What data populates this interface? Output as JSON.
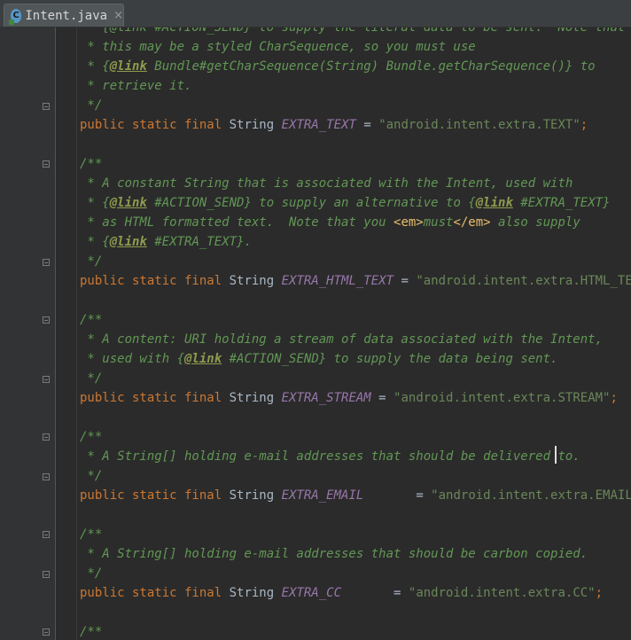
{
  "tab": {
    "label": "Intent.java",
    "icon": "java-class-icon",
    "close": "×"
  },
  "colors": {
    "keyword": "#cc7832",
    "comment": "#629755",
    "string": "#6a8759",
    "constant": "#9876aa",
    "text": "#a9b7c6",
    "background": "#2b2b2b"
  },
  "code": {
    "l0": " * {@link #ACTION_SEND} to supply the literal data to be sent.  Note that",
    "l1": " * this may be a styled CharSequence, so you must use",
    "l2a": " * {",
    "l2b": "@link",
    "l2c": " Bundle#getCharSequence(String) Bundle.getCharSequence()} to",
    "l3": " * retrieve it.",
    "l4": " */",
    "l5": {
      "mod": "public static final",
      "type": " String ",
      "name": "EXTRA_TEXT",
      "eq": " = ",
      "value": "\"android.intent.extra.TEXT\"",
      "end": ";"
    },
    "l7": "/**",
    "l8": " * A constant String that is associated with the Intent, used with",
    "l9a": " * {",
    "l9b": "@link",
    "l9c": " #ACTION_SEND} to supply an alternative to {",
    "l9d": "@link",
    "l9e": " #EXTRA_TEXT}",
    "l10a": " * as HTML formatted text.  Note that you ",
    "l10b": "<em>",
    "l10c": "must",
    "l10d": "</em>",
    "l10e": " also supply",
    "l11a": " * {",
    "l11b": "@link",
    "l11c": " #EXTRA_TEXT}.",
    "l12": " */",
    "l13": {
      "mod": "public static final",
      "type": " String ",
      "name": "EXTRA_HTML_TEXT",
      "eq": " = ",
      "value": "\"android.intent.extra.HTML_TEXT\"",
      "end": ";"
    },
    "l15": "/**",
    "l16": " * A content: URI holding a stream of data associated with the Intent,",
    "l17a": " * used with {",
    "l17b": "@link",
    "l17c": " #ACTION_SEND} to supply the data being sent.",
    "l18": " */",
    "l19": {
      "mod": "public static final",
      "type": " String ",
      "name": "EXTRA_STREAM",
      "eq": " = ",
      "value": "\"android.intent.extra.STREAM\"",
      "end": ";"
    },
    "l21": "/**",
    "l22": " * A String[] holding e-mail addresses that should be delivered to.",
    "l23": " */",
    "l24": {
      "mod": "public static final",
      "type": " String ",
      "name": "EXTRA_EMAIL",
      "eq": "       = ",
      "value": "\"android.intent.extra.EMAIL\"",
      "end": ";"
    },
    "l26": "/**",
    "l27": " * A String[] holding e-mail addresses that should be carbon copied.",
    "l28": " */",
    "l29": {
      "mod": "public static final",
      "type": " String ",
      "name": "EXTRA_CC",
      "eq": "       = ",
      "value": "\"android.intent.extra.CC\"",
      "end": ";"
    },
    "l31": "/**"
  }
}
